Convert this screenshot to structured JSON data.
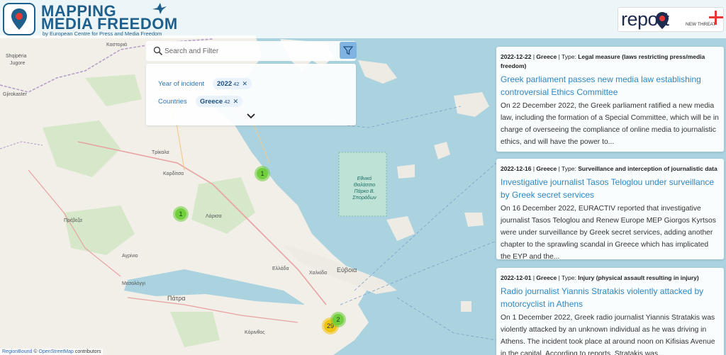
{
  "brand": {
    "line1": "MAPPING",
    "line2": "MEDIA FREEDOM",
    "subtitle": "by European Centre for Press and Media Freedom"
  },
  "report": {
    "text": "report",
    "new_threat": "NEW THREAT"
  },
  "search": {
    "placeholder": "Search and Filter"
  },
  "filters": {
    "year": {
      "label": "Year of incident",
      "value": "2022",
      "count": "42"
    },
    "countries": {
      "label": "Countries",
      "value": "Greece",
      "count": "42"
    }
  },
  "markers": [
    {
      "count": "1",
      "kind": "green"
    },
    {
      "count": "1",
      "kind": "green"
    },
    {
      "count": "29",
      "kind": "yellow"
    },
    {
      "count": "2",
      "kind": "green"
    }
  ],
  "map_labels": {
    "kastoria": "Καστοριά",
    "shqiperia": "Shqipëria",
    "jugore": "Jugore",
    "gjirokaster": "Gjirokaster",
    "trikala": "Τρίκαλα",
    "karditsa": "Καρδίτσα",
    "preveza": "Πρέβεζα",
    "agrinio": "Αγρίνιο",
    "mesologgi": "Μεσολόγγι",
    "patra": "Πάτρα",
    "chalkida": "Χαλκίδα",
    "evia": "Εύβοια",
    "korinthos": "Κόρινθος",
    "larisa": "Λάρισα",
    "ellada": "Ελλάδα"
  },
  "marine_park": "Εθνικό Θαλάσσιο Πάρκο Β. Σποράδων",
  "feed": [
    {
      "date": "2022-12-22",
      "country": "Greece",
      "type_label": "Type:",
      "type": "Legal measure (laws restricting press/media freedom)",
      "title": "Greek parliament passes new media law establishing controversial Ethics Committee",
      "body": "On 22 December 2022, the Greek parliament ratified a new media law, including the formation of a Special Committee, which will be in charge of overseeing the compliance of online media to journalistic ethics, and will have the power to..."
    },
    {
      "date": "2022-12-16",
      "country": "Greece",
      "type_label": "Type:",
      "type": "Surveillance and interception of journalistic data",
      "title": "Investigative journalist Tasos Teloglou under surveillance by Greek secret services",
      "body": "On 16 December 2022, EURACTIV reported that investigative journalist Tasos Teloglou and Renew Europe MEP Giorgos Kyrtsos were under surveillance by Greek secret services, adding another chapter to the sprawling scandal in Greece which has implicated the EYP and the..."
    },
    {
      "date": "2022-12-01",
      "country": "Greece",
      "type_label": "Type:",
      "type": "Injury (physical assault resulting in injury)",
      "title": "Radio journalist Yiannis Stratakis violently attacked by motorcyclist in Athens",
      "body": "On 1 December 2022, Greek radio journalist Yiannis Stratakis was violently attacked by an unknown individual as he was driving in Athens. The incident took place at around noon on Kifisias Avenue in the capital. According to reports, Stratakis was..."
    }
  ],
  "attribution": {
    "region": "RegionBound",
    "osm": "OpenStreetMap",
    "suffix": "contributors"
  },
  "colors": {
    "brand": "#1f5f8b",
    "accent": "#e53935",
    "link": "#2e86c1",
    "sea": "#aad3df",
    "land": "#f2efe9"
  }
}
